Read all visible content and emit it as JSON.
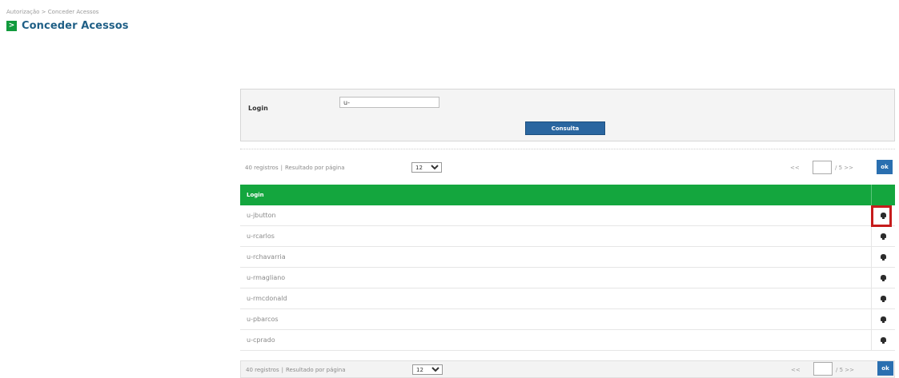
{
  "breadcrumb": "Autorização > Conceder Acessos",
  "page": {
    "title": "Conceder Acessos",
    "title_icon": "arrow-right-square-icon",
    "accent": "#119a3d"
  },
  "search": {
    "label": "Login",
    "value": "u-",
    "button_label": "Consulta"
  },
  "pager": {
    "records": "40 registros",
    "separator": "|",
    "per_page_label": "Resultado por página",
    "per_page_value": "12",
    "prev": "<<",
    "page_value": "",
    "total": "/ 5 >>",
    "ok_label": "ok"
  },
  "table": {
    "header_color": "#14a63e",
    "columns": [
      "Login"
    ],
    "rows": [
      {
        "login": "u-jbutton"
      },
      {
        "login": "u-rcarlos"
      },
      {
        "login": "u-rchavarria"
      },
      {
        "login": "u-rmagliano"
      },
      {
        "login": "u-rmcdonald"
      },
      {
        "login": "u-pbarcos"
      },
      {
        "login": "u-cprado"
      }
    ]
  },
  "highlight_color": "#c61c1c"
}
